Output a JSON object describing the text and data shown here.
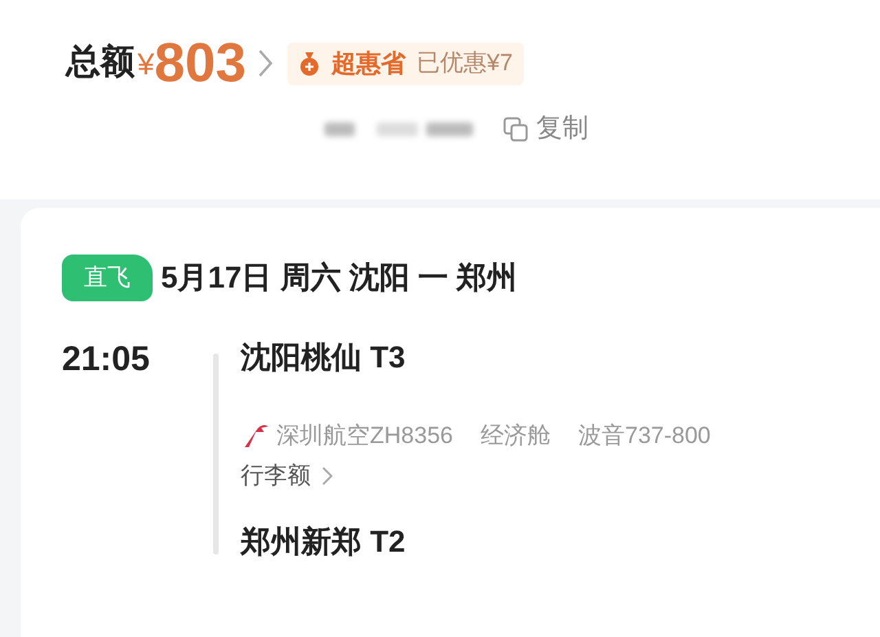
{
  "total": {
    "label": "总额",
    "currency": "¥",
    "amount": "803"
  },
  "promo": {
    "badge": "超惠省",
    "saved": "已优惠¥7"
  },
  "order": {
    "copy": "复制"
  },
  "flight": {
    "tag": "直飞",
    "title": "5月17日 周六 沈阳 一 郑州",
    "time": "21:05",
    "departure": "沈阳桃仙 T3",
    "airline": "深圳航空ZH8356",
    "cabin": "经济舱",
    "aircraft": "波音737-800",
    "baggage": "行李额",
    "arrival": "郑州新郑 T2"
  }
}
